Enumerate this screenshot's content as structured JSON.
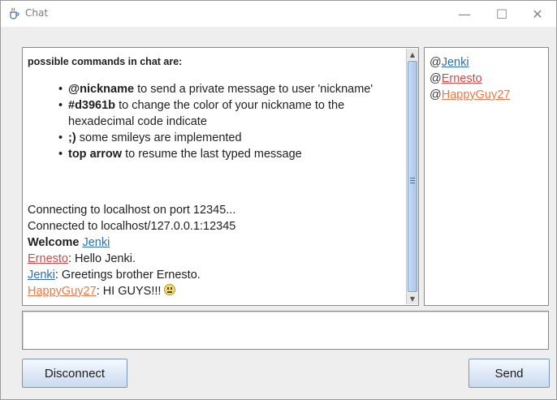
{
  "window": {
    "title": "Chat",
    "controls": {
      "minimize": "—",
      "maximize": "☐",
      "close": "✕"
    }
  },
  "chat": {
    "commands_title": "possible commands in chat are:",
    "commands": [
      {
        "keyword": "@nickname",
        "text": " to send a private message to user 'nickname'"
      },
      {
        "keyword": "#d3961b",
        "text": " to change the color of your nickname to the hexadecimal code indicate"
      },
      {
        "keyword": ";)",
        "text": " some smileys are implemented"
      },
      {
        "keyword": "top arrow",
        "text": " to resume the last typed message"
      }
    ],
    "log": {
      "connecting": "Connecting to localhost on port 12345...",
      "connected": "Connected to localhost/127.0.0.1:12345",
      "welcome_label": "Welcome",
      "welcome_user": "Jenki",
      "messages": [
        {
          "user": "Ernesto",
          "sep": ":",
          "text": " Hello Jenki."
        },
        {
          "user": "Jenki",
          "sep": ":",
          "text": " Greetings brother Ernesto."
        },
        {
          "user": "HappyGuy27",
          "sep": ":",
          "text": " HI GUYS!!!"
        }
      ]
    }
  },
  "users": [
    {
      "prefix": "@",
      "name": "Jenki",
      "color": "#2f6ea8"
    },
    {
      "prefix": "@",
      "name": "Ernesto",
      "color": "#c84c4c"
    },
    {
      "prefix": "@",
      "name": "HappyGuy27",
      "color": "#e07d4a"
    }
  ],
  "input": {
    "value": ""
  },
  "buttons": {
    "disconnect": "Disconnect",
    "send": "Send"
  },
  "icons": {
    "app": "java-cup-icon",
    "smiley": "smiley-icon"
  },
  "colors": {
    "accent": "#a8c6ea",
    "jenki": "#2f6ea8",
    "ernesto": "#c84c4c",
    "happyguy27": "#e07d4a"
  }
}
